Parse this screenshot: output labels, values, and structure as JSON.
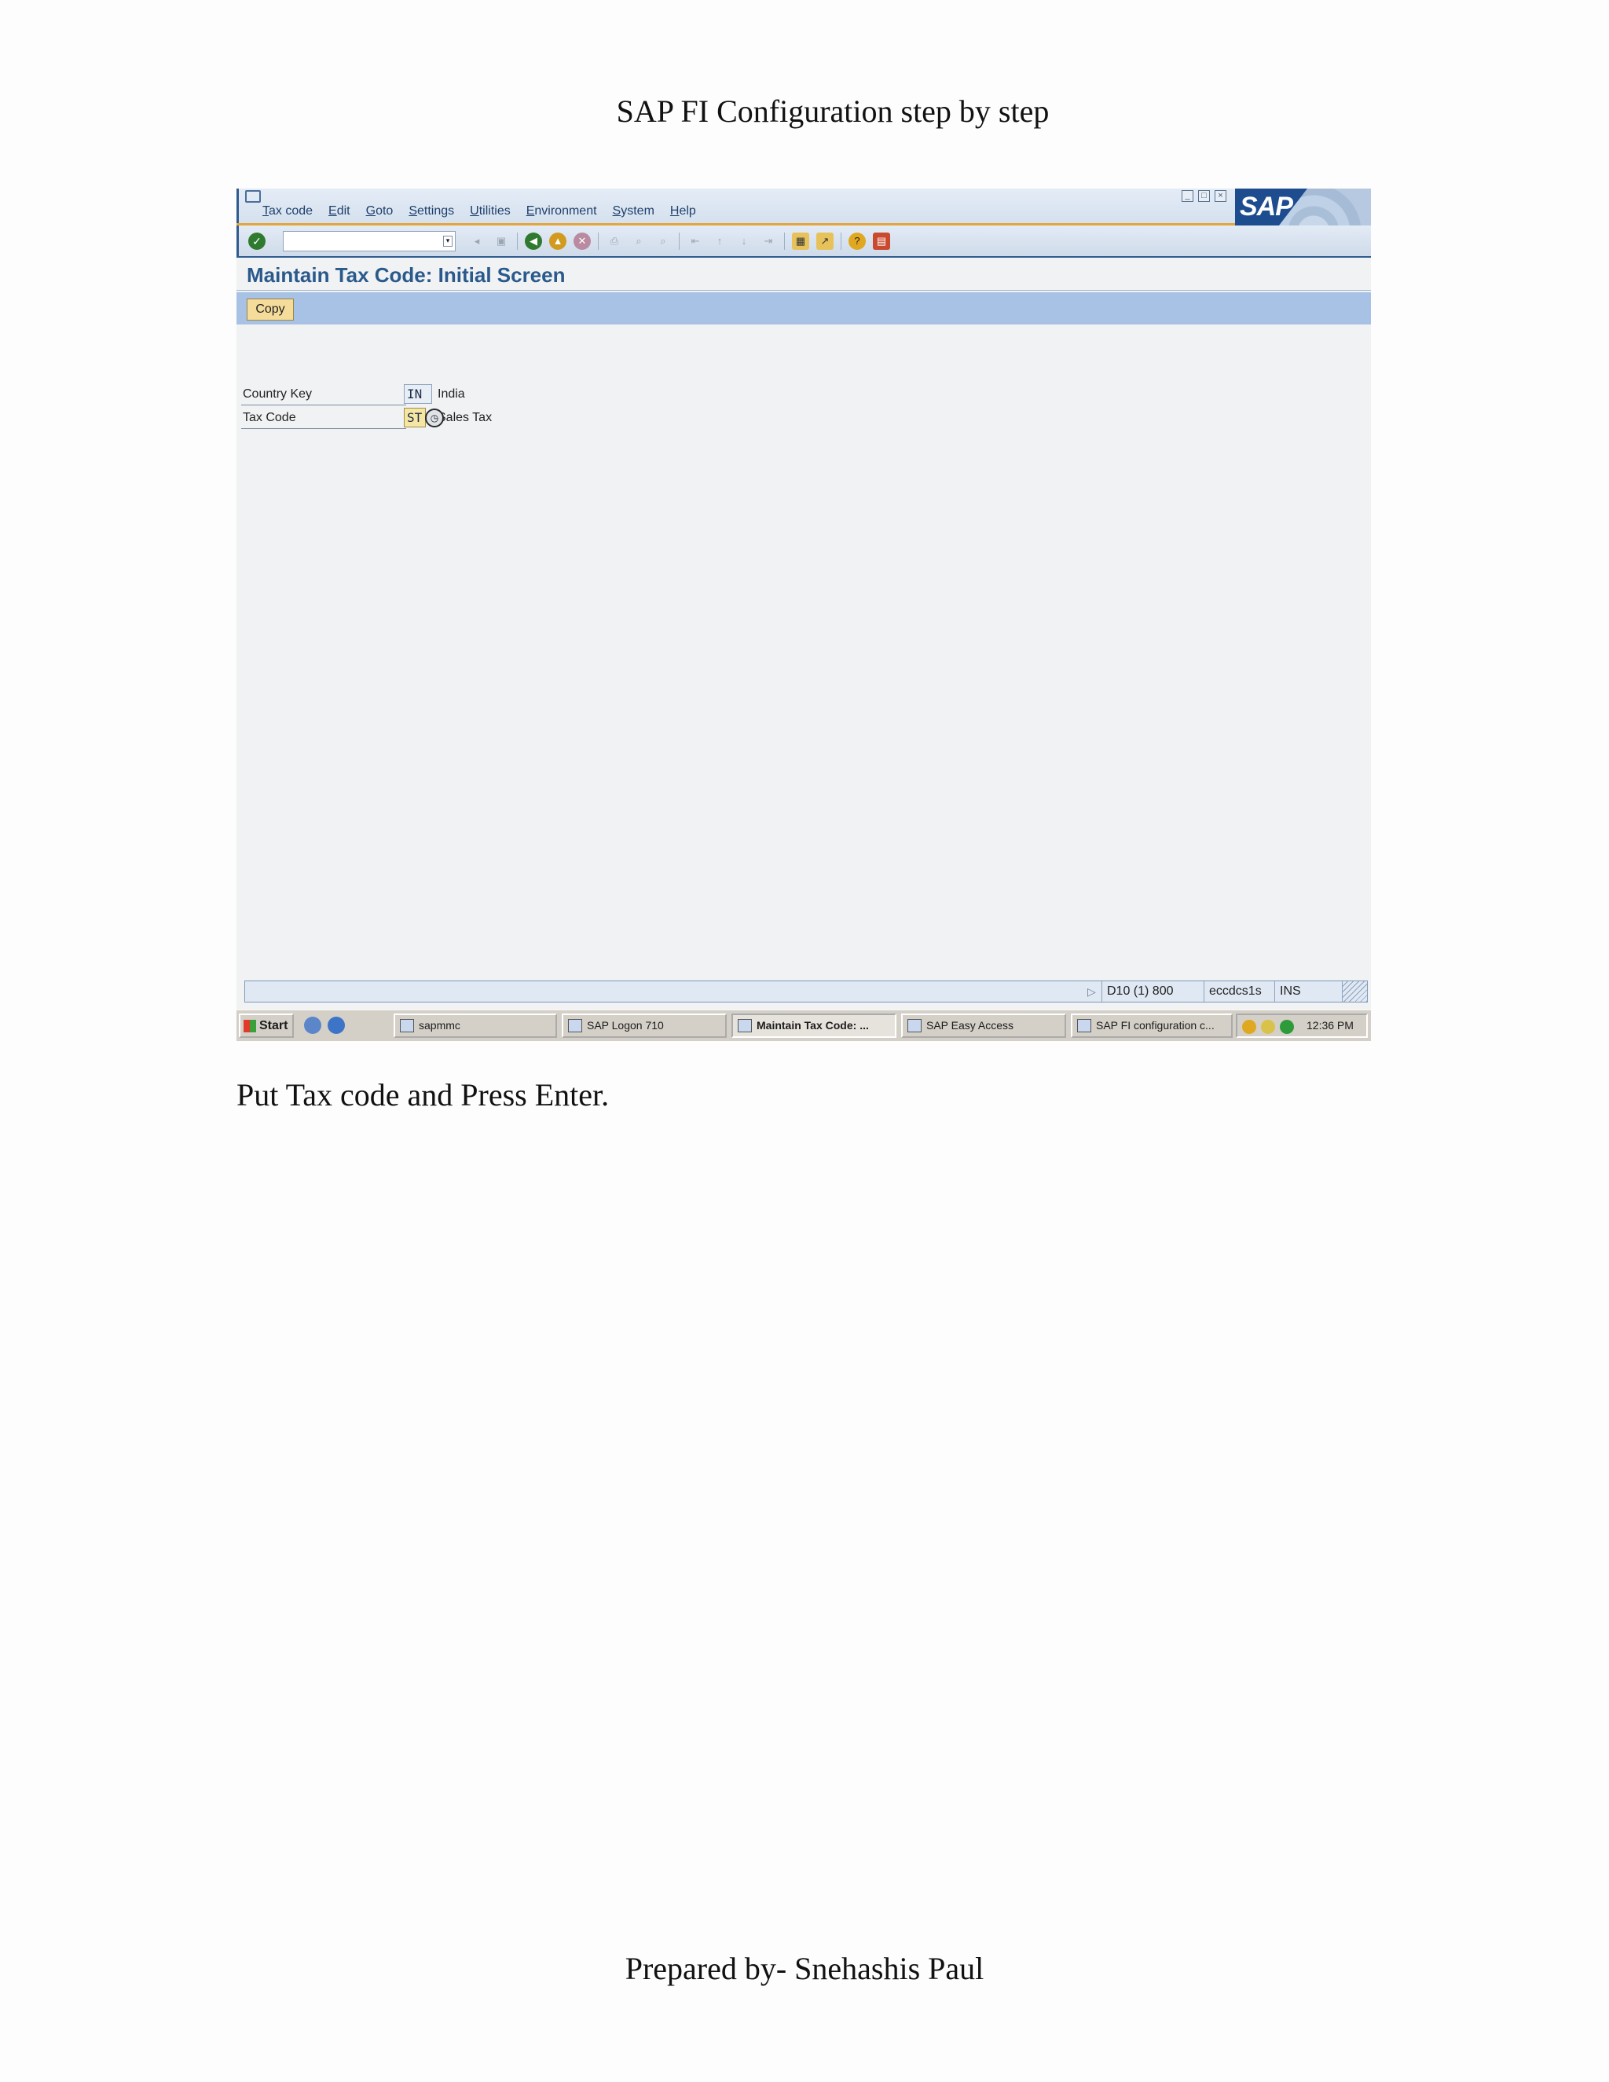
{
  "document": {
    "title": "SAP FI Configuration step by step",
    "instruction": "Put Tax code and Press Enter.",
    "footer": "Prepared by- Snehashis Paul"
  },
  "sap": {
    "menu": [
      "Tax code",
      "Edit",
      "Goto",
      "Settings",
      "Utilities",
      "Environment",
      "System",
      "Help"
    ],
    "logo_text": "SAP",
    "command_field": {
      "value": ""
    },
    "screen_title": "Maintain Tax Code: Initial Screen",
    "app_toolbar": {
      "copy_label": "Copy"
    },
    "fields": {
      "country_key": {
        "label": "Country Key",
        "value": "IN",
        "description": "India"
      },
      "tax_code": {
        "label": "Tax Code",
        "value": "ST",
        "description": "Sales Tax"
      }
    },
    "status_bar": {
      "system": "D10 (1) 800",
      "server": "eccdcs1s",
      "mode": "INS"
    },
    "icons": {
      "enter": "check-icon",
      "back": "back-icon",
      "exit": "exit-icon",
      "cancel": "cancel-icon",
      "save": "save-icon",
      "print": "print-icon",
      "find": "find-icon",
      "help": "help-icon"
    }
  },
  "taskbar": {
    "start_label": "Start",
    "tasks": [
      {
        "label": "sapmmc",
        "active": false
      },
      {
        "label": "SAP Logon 710",
        "active": false
      },
      {
        "label": "Maintain Tax Code: ...",
        "active": true
      },
      {
        "label": "SAP Easy Access",
        "active": false
      },
      {
        "label": "SAP FI configuration c...",
        "active": false
      }
    ],
    "clock": "12:36 PM"
  },
  "colors": {
    "sap_blue": "#2a5a8c",
    "app_toolbar": "#a7c2e4",
    "input_active": "#f6e6a3",
    "copy_button": "#f5dc9b"
  }
}
